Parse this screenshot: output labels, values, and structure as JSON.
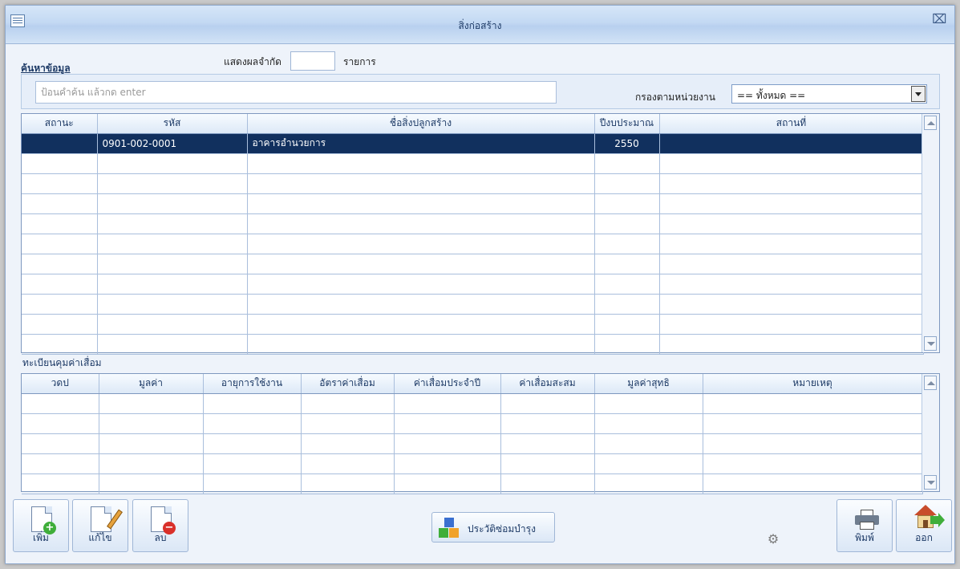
{
  "window": {
    "title": "สิ่งก่อสร้าง",
    "close_glyph": "⌧"
  },
  "search": {
    "label": "ค้นหาข้อมูล",
    "limit_label": "แสดงผลจำกัด",
    "limit_value": "",
    "items_label": "รายการ",
    "placeholder": "ป้อนคำค้น แล้วกด enter",
    "filter_label": "กรองตามหน่วยงาน",
    "filter_value": "== ทั้งหมด =="
  },
  "main_grid": {
    "columns": [
      "สถานะ",
      "รหัส",
      "ชื่อสิ่งปลูกสร้าง",
      "ปีงบประมาณ",
      "สถานที่"
    ],
    "rows": [
      {
        "status": "",
        "code": "0901-002-0001",
        "name": "อาคารอำนวยการ",
        "year": "2550",
        "place": ""
      }
    ]
  },
  "depreciation": {
    "label": "ทะเบียนคุมค่าเสื่อม",
    "columns": [
      "วดป",
      "มูลค่า",
      "อายุการใช้งาน",
      "อัตราค่าเสื่อม",
      "ค่าเสื่อมประจำปี",
      "ค่าเสื่อมสะสม",
      "มูลค่าสุทธิ",
      "หมายเหตุ"
    ]
  },
  "toolbar": {
    "add_label": "เพิ่ม",
    "edit_label": "แก้ไข",
    "delete_label": "ลบ",
    "history_label": "ประวัติซ่อมบำรุง",
    "print_label": "พิมพ์",
    "exit_label": "ออก"
  },
  "colors": {
    "selected_row": "#11305e",
    "accent": "#1d3a66"
  }
}
